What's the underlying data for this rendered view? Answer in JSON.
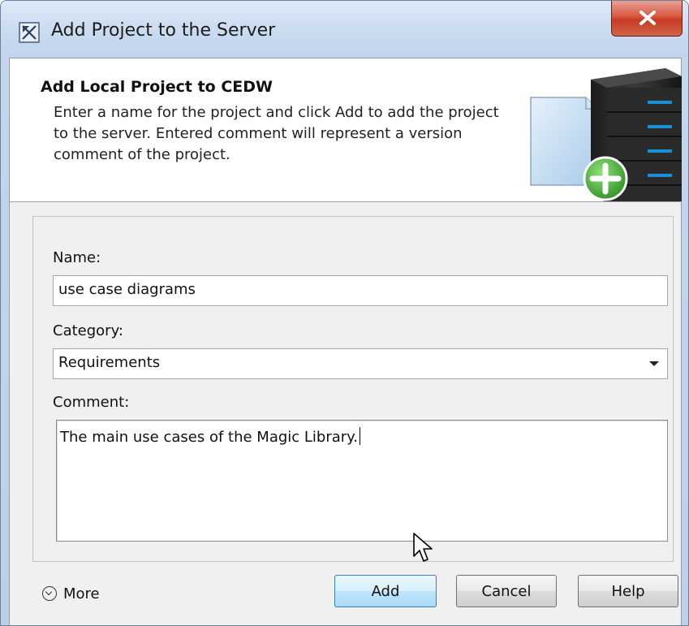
{
  "window": {
    "title": "Add Project to the Server",
    "close_label": "X"
  },
  "header": {
    "title": "Add Local Project to CEDW",
    "description": "Enter a name for the project and click Add to add the project to the server. Entered comment will represent a version comment of the project."
  },
  "form": {
    "name_label": "Name:",
    "name_value": "use case diagrams",
    "category_label": "Category:",
    "category_value": "Requirements",
    "comment_label": "Comment:",
    "comment_value": "The main use cases of the Magic Library."
  },
  "footer": {
    "more_label": "More",
    "add_label": "Add",
    "cancel_label": "Cancel",
    "help_label": "Help"
  },
  "colors": {
    "accent_blue": "#3c7fb1",
    "close_red": "#c53a22",
    "plus_green": "#3ea52e"
  }
}
